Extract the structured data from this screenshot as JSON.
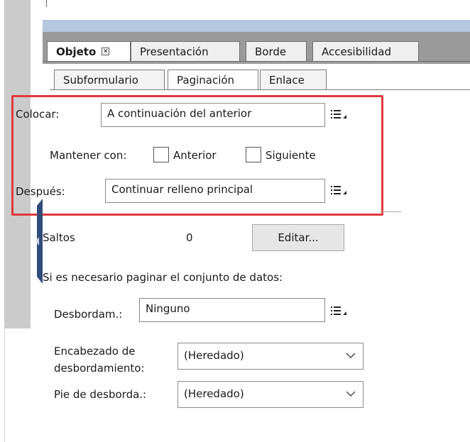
{
  "tabs": [
    {
      "label": "Objeto",
      "active": true,
      "closable": true
    },
    {
      "label": "Presentación"
    },
    {
      "label": "Borde"
    },
    {
      "label": "Accesibilidad"
    }
  ],
  "subtabs": [
    {
      "label": "Subformulario"
    },
    {
      "label": "Paginación",
      "active": true
    },
    {
      "label": "Enlace"
    }
  ],
  "colocar": {
    "label": "Colocar:",
    "value": "A continuación del anterior",
    "menu_icon": "list-menu-icon"
  },
  "mantener": {
    "label": "Mantener con:",
    "anterior_label": "Anterior",
    "anterior_checked": false,
    "siguiente_label": "Siguiente",
    "siguiente_checked": false
  },
  "despues": {
    "label": "Después:",
    "value": "Continuar relleno principal",
    "menu_icon": "list-menu-icon"
  },
  "saltos": {
    "label": "Saltos",
    "count": "0",
    "edit_label": "Editar..."
  },
  "paginate_heading": "Si es necesario paginar el conjunto de datos:",
  "desbordam": {
    "label": "Desbordam.:",
    "value": "Ninguno",
    "menu_icon": "list-menu-icon"
  },
  "encabezado": {
    "label_line1": "Encabezado de",
    "label_line2": "desbordamiento:",
    "value": "(Heredado)"
  },
  "pie": {
    "label": "Pie de desborda.:",
    "value": "(Heredado)"
  },
  "colors": {
    "highlight": "#e0393e",
    "header_bar": "#b6c8df",
    "tabbar": "#9a9a9a"
  }
}
